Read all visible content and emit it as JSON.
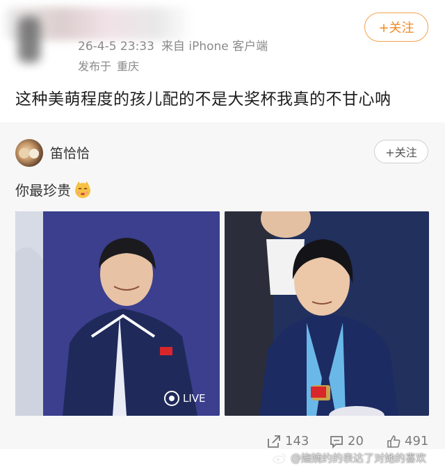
{
  "post": {
    "date": "26-4-5 23:33",
    "source": "来自 iPhone 客户端",
    "location_prefix": "发布于",
    "location": "重庆",
    "follow_label": "+关注",
    "text": "这种美萌程度的孩儿配的不是大奖杯我真的不甘心呐"
  },
  "repost": {
    "username": "笛恰恰",
    "follow_label": "+关注",
    "text": "你最珍贵",
    "emoji": "smiling-cat-emoji",
    "images": [
      {
        "name": "photo-left",
        "badge": "LIVE"
      },
      {
        "name": "photo-right"
      }
    ]
  },
  "actions": {
    "reposts": "143",
    "comments": "20",
    "likes": "491"
  },
  "watermark": "@嫵婉约的表达了对她的喜欢",
  "colors": {
    "accent": "#f08a24",
    "meta_gray": "#8a8a8a",
    "repost_bg": "#f7f7f7"
  }
}
